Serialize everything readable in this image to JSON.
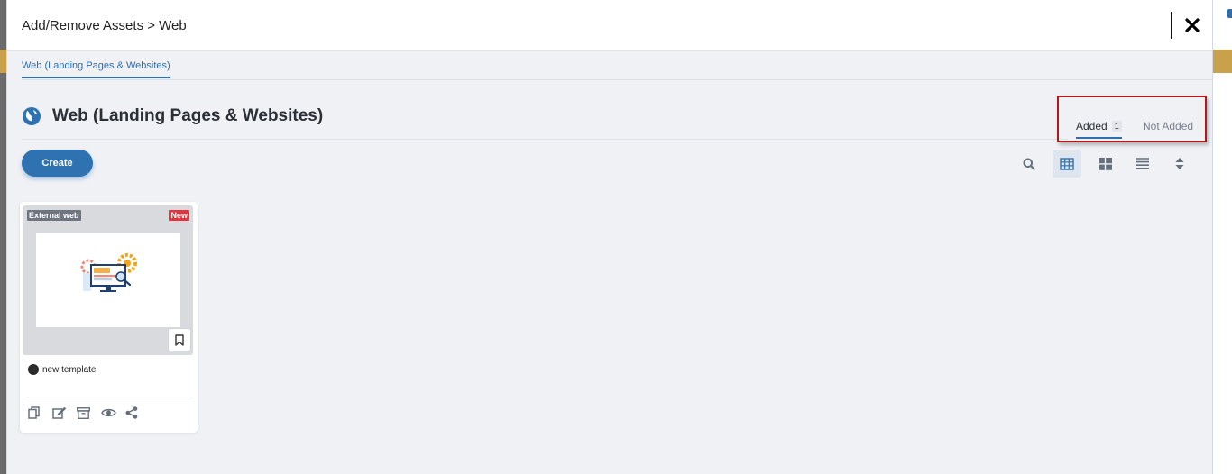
{
  "modal": {
    "title": "Add/Remove Assets > Web"
  },
  "subtabs": [
    {
      "label": "Web (Landing Pages & Websites)",
      "active": true
    }
  ],
  "section": {
    "title": "Web (Landing Pages & Websites)",
    "icon": "globe-icon"
  },
  "filter_tabs": {
    "added_label": "Added",
    "added_count": "1",
    "not_added_label": "Not Added",
    "active": "Added"
  },
  "toolbar": {
    "create_label": "Create",
    "icons": [
      "search-icon",
      "table-view-icon",
      "grid-view-icon",
      "list-view-icon",
      "sort-icon"
    ],
    "active_view": "table-view-icon"
  },
  "cards": [
    {
      "type_tag": "External web",
      "new_tag": "New",
      "name": "new template",
      "actions": [
        "copy-icon",
        "edit-icon",
        "archive-icon",
        "preview-icon",
        "share-icon"
      ]
    }
  ],
  "colors": {
    "accent": "#2f72b2",
    "highlight_box": "#b0171c",
    "new_tag": "#e0353d",
    "modal_bg": "#f0f1f5"
  }
}
